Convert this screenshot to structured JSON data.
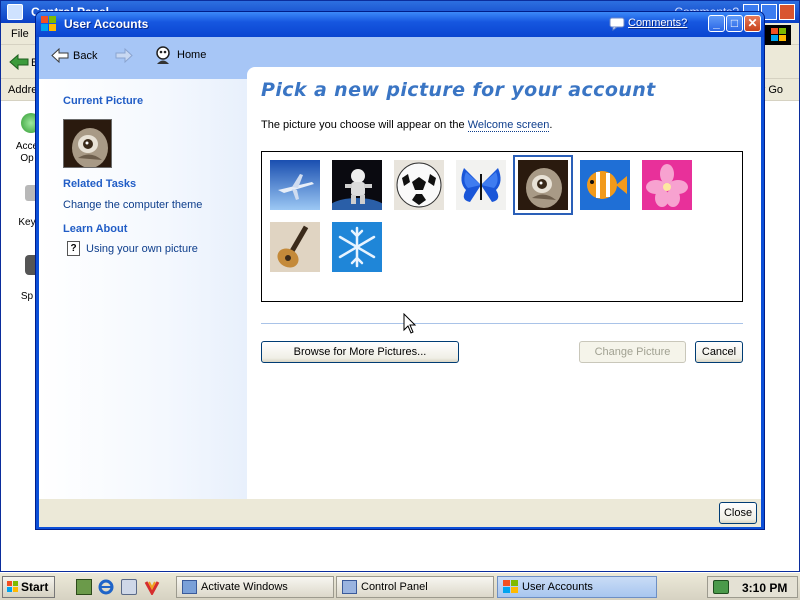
{
  "background_window": {
    "title": "Control Panel",
    "comments_link": "Comments?",
    "menu_file": "File",
    "back_partial": "B",
    "address_label": "Addre",
    "go_label": "r Go",
    "items": [
      {
        "label_line1": "Acce",
        "label_line2": "Op"
      },
      {
        "label_line1": "Key",
        "label_line2": ""
      },
      {
        "label_line1": "Sp",
        "label_line2": ""
      }
    ]
  },
  "dialog": {
    "title": "User Accounts",
    "comments_link": "Comments?",
    "controls": {
      "minimize": "_",
      "maximize": "□",
      "close": "✕"
    },
    "nav": {
      "back_label": "Back",
      "home_label": "Home"
    },
    "left_pane": {
      "current_picture_heading": "Current Picture",
      "related_tasks_heading": "Related Tasks",
      "related_tasks": [
        "Change the computer theme"
      ],
      "learn_about_heading": "Learn About",
      "learn_about": [
        "Using your own picture"
      ]
    },
    "main": {
      "title": "Pick a new picture for your account",
      "description_prefix": "The picture you choose will appear on the ",
      "description_link": "Welcome screen",
      "description_suffix": ".",
      "pictures": [
        {
          "name": "airplane",
          "selected": false
        },
        {
          "name": "astronaut",
          "selected": false
        },
        {
          "name": "soccer-ball",
          "selected": false
        },
        {
          "name": "butterfly",
          "selected": false
        },
        {
          "name": "owl",
          "selected": true
        },
        {
          "name": "fish",
          "selected": false
        },
        {
          "name": "flower",
          "selected": false
        },
        {
          "name": "guitar",
          "selected": false
        },
        {
          "name": "snowflake",
          "selected": false
        }
      ],
      "browse_button": "Browse for More Pictures...",
      "change_button": "Change Picture",
      "change_button_enabled": false,
      "cancel_button": "Cancel"
    },
    "close_button": "Close"
  },
  "taskbar": {
    "start_label": "Start",
    "tasks": [
      {
        "label": "Activate Windows",
        "active": false
      },
      {
        "label": "Control Panel",
        "active": false
      },
      {
        "label": "User Accounts",
        "active": true
      }
    ],
    "clock": "3:10 PM"
  },
  "colors": {
    "title_bar": "#1657e0",
    "nav_bar": "#a7c6f6",
    "heading_blue": "#215dc6",
    "title_text": "#3a75c4",
    "selection": "#2a5fb8"
  }
}
